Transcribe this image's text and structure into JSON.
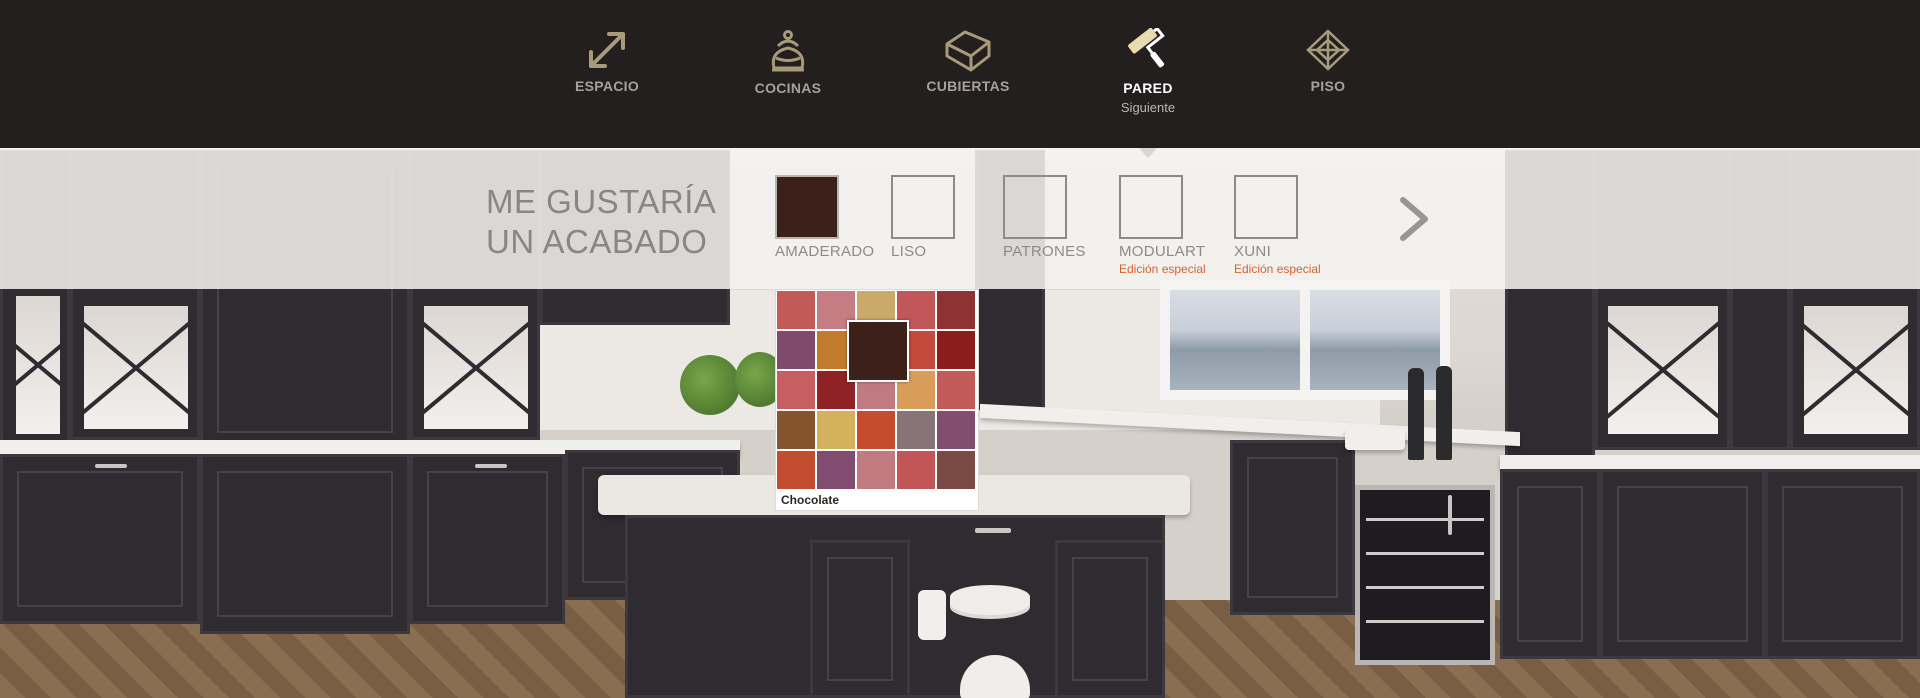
{
  "nav": {
    "items": [
      {
        "label": "ESPACIO",
        "icon": "resize-arrow-icon"
      },
      {
        "label": "COCINAS",
        "icon": "kettle-icon"
      },
      {
        "label": "CUBIERTAS",
        "icon": "countertop-box-icon"
      },
      {
        "label": "PARED",
        "icon": "paint-roller-icon",
        "active": true,
        "sub": "Siguiente"
      },
      {
        "label": "PISO",
        "icon": "floor-tile-pattern-icon"
      }
    ]
  },
  "selector": {
    "heading_line1": "ME GUSTARÍA",
    "heading_line2": "UN ACABADO",
    "options": [
      {
        "label": "AMADERADO",
        "selected": true,
        "color": "#3c201a"
      },
      {
        "label": "LISO"
      },
      {
        "label": "PATRONES"
      },
      {
        "label": "MODULART",
        "special": "Edición especial"
      },
      {
        "label": "XUNI",
        "special": "Edición especial"
      }
    ],
    "next_icon": "chevron-right-icon"
  },
  "picker": {
    "selected_name": "Chocolate",
    "selected_color": "#3c201a",
    "colors": [
      "#c25a58",
      "#c57c82",
      "#c9aa6a",
      "#c2575a",
      "#8e3234",
      "#7f4a6c",
      "#c07c2c",
      "#b64a30",
      "#c34a3c",
      "#8b1e1c",
      "#c75e60",
      "#8f2224",
      "#c07a82",
      "#d89d59",
      "#c25a5a",
      "#85532e",
      "#d5b15d",
      "#c54c2e",
      "#877476",
      "#814e70",
      "#c24d30",
      "#814c70",
      "#c07a80",
      "#c25656",
      "#7c4a44"
    ]
  }
}
